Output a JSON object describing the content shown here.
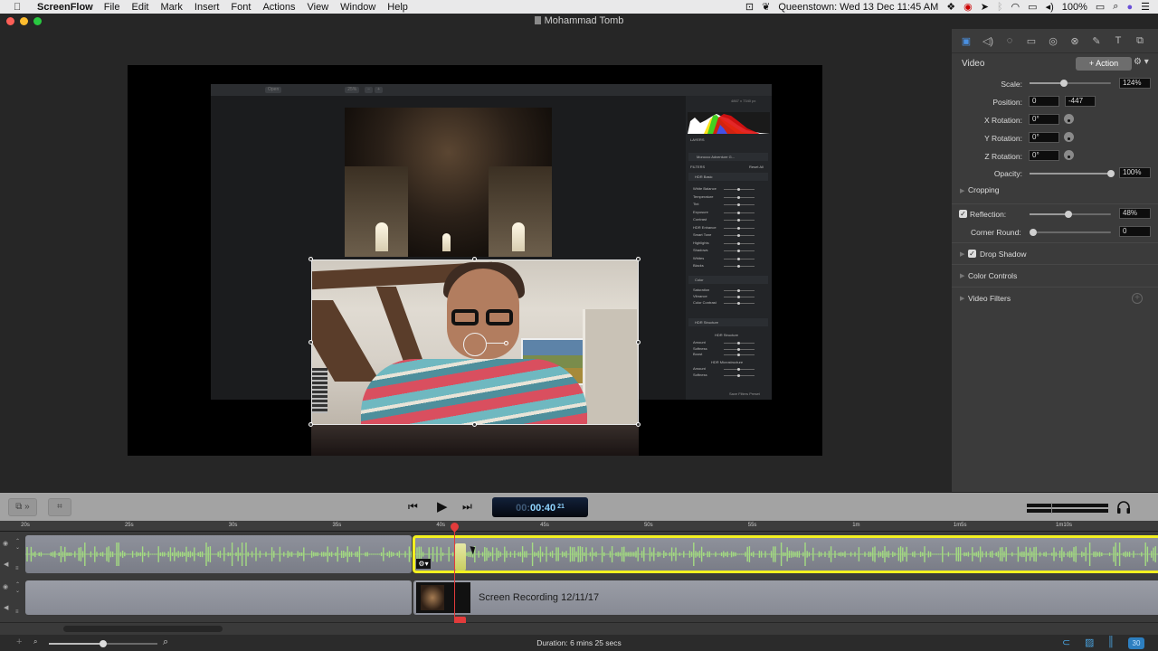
{
  "menubar": {
    "apple_icon": "apple-logo",
    "app_name": "ScreenFlow",
    "menus": [
      "File",
      "Edit",
      "Mark",
      "Insert",
      "Font",
      "Actions",
      "View",
      "Window",
      "Help"
    ],
    "status": {
      "clock": "Queenstown: Wed 13 Dec  11:45 AM",
      "battery": "100%",
      "icons": [
        "screen-record-icon",
        "evernote-icon",
        "dropbox-icon",
        "creative-cloud-icon",
        "forward-icon",
        "bluetooth-icon",
        "wifi-icon",
        "airplay-icon",
        "volume-icon",
        "battery-icon",
        "spotlight-icon",
        "siri-icon",
        "notification-center-icon"
      ]
    }
  },
  "window": {
    "title": "Mohammad Tomb"
  },
  "preview": {
    "inner_app": {
      "toolbar": [
        "Open",
        "25%",
        "−",
        "+"
      ],
      "panels": {
        "layers_label": "LAYERS",
        "filters_label": "FILTERS",
        "reset_label": "Reset All",
        "layer_name": "Morocco Adventure G...",
        "hdr_basic": "HDR Basic",
        "hdr_basic_rows": [
          "White Balance",
          "Temperature",
          "Tint",
          "Exposure",
          "Contrast",
          "HDR Enhance",
          "Smart Tone",
          "Highlights",
          "Shadows",
          "Whites",
          "Blacks"
        ],
        "color_section": "Color",
        "color_rows": [
          "Saturation",
          "Vibrance",
          "Color Contrast"
        ],
        "hdr_structure": "HDR Structure",
        "hdr_structure_rows": [
          "Amount",
          "Softness",
          "Boost"
        ],
        "hdr_micro": "HDR Microstructure",
        "hdr_micro_rows": [
          "Amount",
          "Softness"
        ],
        "save_preset": "Save Filters Preset",
        "image_info": "4867 x 7340 px"
      }
    }
  },
  "inspector": {
    "tabs": [
      {
        "name": "video",
        "icon": "▣",
        "active": true
      },
      {
        "name": "audio",
        "icon": "◁)",
        "active": false
      },
      {
        "name": "screen-recording",
        "icon": "◌",
        "active": false
      },
      {
        "name": "callout",
        "icon": "▭",
        "active": false
      },
      {
        "name": "touch-callout",
        "icon": "◎",
        "active": false
      },
      {
        "name": "annotations",
        "icon": "⊗",
        "active": false
      },
      {
        "name": "annotation-pen",
        "icon": "✎",
        "active": false
      },
      {
        "name": "text",
        "icon": "T",
        "active": false
      },
      {
        "name": "media-library",
        "icon": "⧉",
        "active": false
      }
    ],
    "section_title": "Video",
    "action_label": "+ Action",
    "gear": "⚙ ▾",
    "scale": {
      "label": "Scale:",
      "value": "124%",
      "slider": 0.42
    },
    "position": {
      "label": "Position:",
      "x": "0",
      "y": "-447"
    },
    "x_rotation": {
      "label": "X Rotation:",
      "value": "0°"
    },
    "y_rotation": {
      "label": "Y Rotation:",
      "value": "0°"
    },
    "z_rotation": {
      "label": "Z Rotation:",
      "value": "0°"
    },
    "opacity": {
      "label": "Opacity:",
      "value": "100%",
      "slider": 1.0
    },
    "cropping": {
      "label": "Cropping"
    },
    "reflection": {
      "label": "Reflection:",
      "value": "48%",
      "checked": true,
      "slider": 0.48
    },
    "corner_round": {
      "label": "Corner Round:",
      "value": "0",
      "slider": 0.0
    },
    "drop_shadow": {
      "label": "Drop Shadow",
      "checked": true
    },
    "color_controls": {
      "label": "Color Controls"
    },
    "video_filters": {
      "label": "Video Filters",
      "add": "+"
    }
  },
  "transport": {
    "layout_button": "⧉ »",
    "crop_button": "⌗",
    "rewind": "⏮",
    "play": "▶",
    "fast_forward": "⏭",
    "timecode": {
      "dim": "00:",
      "main": "00:40",
      "frames": "21"
    },
    "headphones": "headphones-icon"
  },
  "ruler": {
    "ticks": [
      "20s",
      "25s",
      "30s",
      "35s",
      "40s",
      "45s",
      "50s",
      "55s",
      "1m",
      "1m5s",
      "1m10s"
    ]
  },
  "timeline": {
    "tracks": [
      {
        "name": "track-1",
        "clip_label": ""
      },
      {
        "name": "track-2",
        "clip_label": "Screen Recording 12/11/17"
      }
    ],
    "playhead_time": "00:00:40;21"
  },
  "bottombar": {
    "add": "+",
    "duration": "Duration: 6 mins 25 secs",
    "zoom_level": 0.5,
    "fps": "30"
  }
}
